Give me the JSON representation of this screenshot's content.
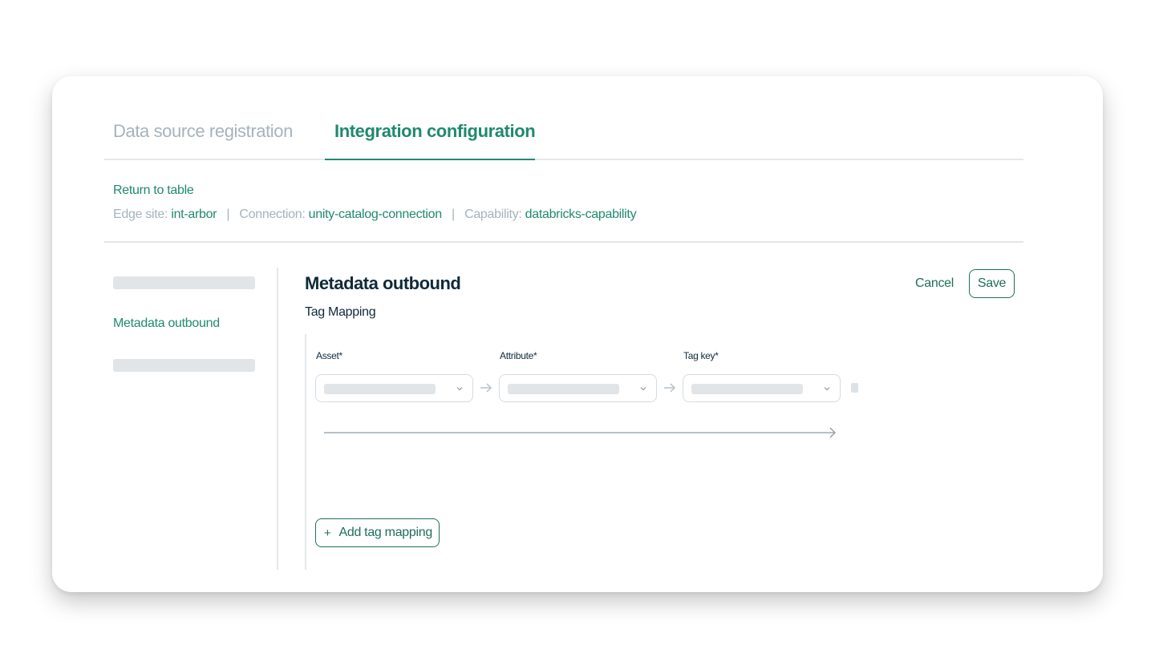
{
  "tabs": {
    "registration": "Data source registration",
    "integration": "Integration configuration"
  },
  "breadcrumb": {
    "return_label": "Return to table",
    "edge_site_label": "Edge site:",
    "edge_site_value": "int-arbor",
    "connection_label": "Connection:",
    "connection_value": "unity-catalog-connection",
    "capability_label": "Capability:",
    "capability_value": "databricks-capability",
    "separator": "|"
  },
  "sidebar": {
    "items": [
      {
        "label": "Metadata outbound",
        "active": true
      }
    ]
  },
  "main": {
    "title": "Metadata outbound",
    "subtitle": "Tag Mapping",
    "cancel_label": "Cancel",
    "save_label": "Save",
    "fields": {
      "asset": "Asset*",
      "attribute": "Attribute*",
      "tag_key": "Tag key*"
    },
    "add_label": "Add tag mapping",
    "add_icon": "+"
  },
  "colors": {
    "accent": "#1f8a6f",
    "accent_dark": "#1f6f5a",
    "muted": "#a6b3bc",
    "divider": "#e3e7ea",
    "skeleton": "#e1e5e8"
  },
  "icons": [
    "chevron-down-icon",
    "arrow-right-icon",
    "plus-icon"
  ]
}
